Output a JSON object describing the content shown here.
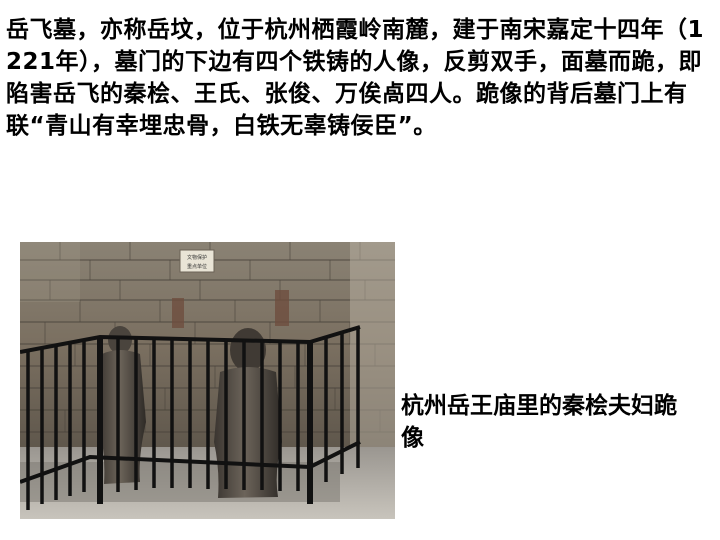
{
  "document": {
    "paragraph": "岳飞墓，亦称岳坟，位于杭州栖霞岭南麓，建于南宋嘉定十四年（1221年），墓门的下边有四个铁铸的人像，反剪双手，面墓而跪，即陷害岳飞的秦桧、王氏、张俊、万俟卨四人。跪像的背后墓门上有联“青山有幸埋忠骨，白铁无辜铸佞臣”。",
    "caption": "杭州岳王庙里的秦桧夫妇跪像",
    "photo": {
      "sign_line1": "文物保护",
      "sign_line2": "重点单位"
    }
  }
}
